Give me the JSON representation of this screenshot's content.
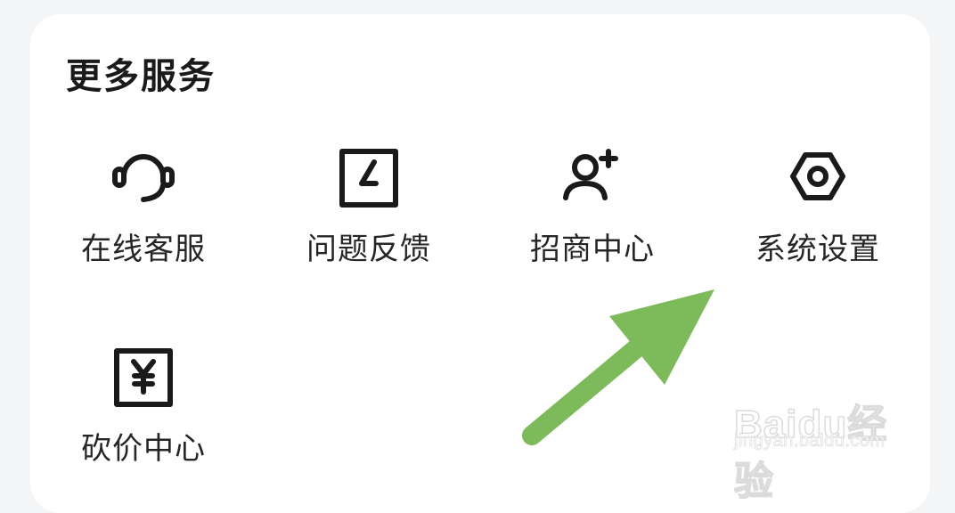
{
  "section": {
    "title": "更多服务"
  },
  "services": [
    {
      "label": "在线客服",
      "icon": "headset-icon"
    },
    {
      "label": "问题反馈",
      "icon": "feedback-icon"
    },
    {
      "label": "招商中心",
      "icon": "add-user-icon"
    },
    {
      "label": "系统设置",
      "icon": "hex-nut-settings-icon"
    },
    {
      "label": "砍价中心",
      "icon": "yen-document-icon"
    }
  ],
  "annotation": {
    "arrow_color": "#7cba5a",
    "points_to": "系统设置"
  },
  "watermark": {
    "logo": "Baidu经验",
    "url": "jingyan.baidu.com"
  },
  "colors": {
    "background": "#f4f5f7",
    "card": "#ffffff",
    "icon": "#1a1a1a",
    "text": "#262626"
  }
}
